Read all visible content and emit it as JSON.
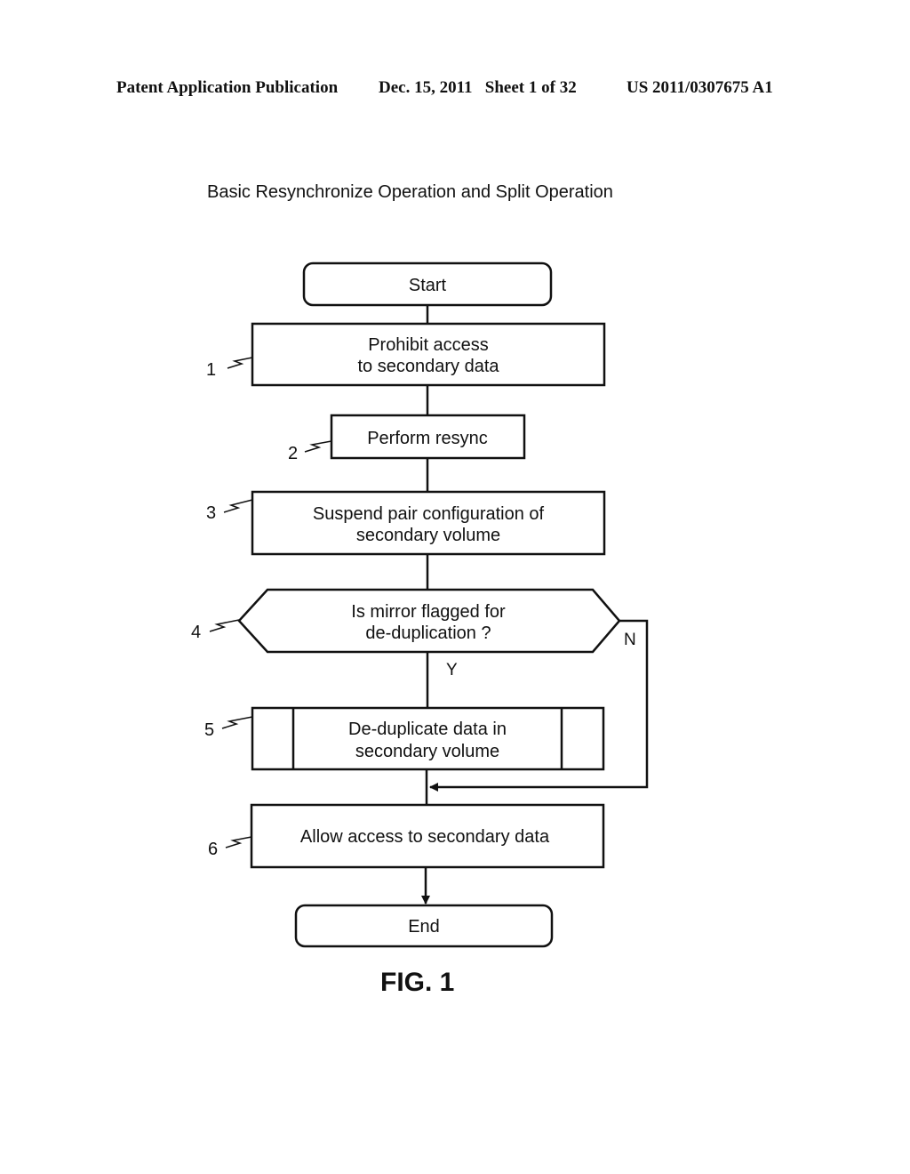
{
  "header": {
    "left": "Patent Application Publication",
    "date_sheet": "Dec. 15, 2011   Sheet 1 of 32",
    "number": "US 2011/0307675 A1"
  },
  "diagram": {
    "title": "Basic Resynchronize Operation and Split Operation",
    "figure_label": "FIG. 1",
    "nodes": {
      "start": {
        "type": "terminal",
        "lines": [
          "Start"
        ]
      },
      "step1": {
        "type": "process",
        "ref": "1",
        "lines": [
          "Prohibit access",
          "to secondary data"
        ]
      },
      "step2": {
        "type": "process",
        "ref": "2",
        "lines": [
          "Perform resync"
        ]
      },
      "step3": {
        "type": "process",
        "ref": "3",
        "lines": [
          "Suspend pair configuration of",
          "secondary volume"
        ]
      },
      "step4": {
        "type": "decision",
        "ref": "4",
        "lines": [
          "Is mirror flagged for",
          "de-duplication ?"
        ]
      },
      "step5": {
        "type": "predefined-process",
        "ref": "5",
        "lines": [
          "De-duplicate data in",
          "secondary volume"
        ]
      },
      "step6": {
        "type": "process",
        "ref": "6",
        "lines": [
          "Allow access to secondary data"
        ]
      },
      "end": {
        "type": "terminal",
        "lines": [
          "End"
        ]
      }
    },
    "edges": [
      {
        "from": "start",
        "to": "step1"
      },
      {
        "from": "step1",
        "to": "step2"
      },
      {
        "from": "step2",
        "to": "step3"
      },
      {
        "from": "step3",
        "to": "step4"
      },
      {
        "from": "step4",
        "to": "step5",
        "label": "Y"
      },
      {
        "from": "step4",
        "to": "step6",
        "label": "N"
      },
      {
        "from": "step5",
        "to": "step6"
      },
      {
        "from": "step6",
        "to": "end"
      }
    ]
  }
}
